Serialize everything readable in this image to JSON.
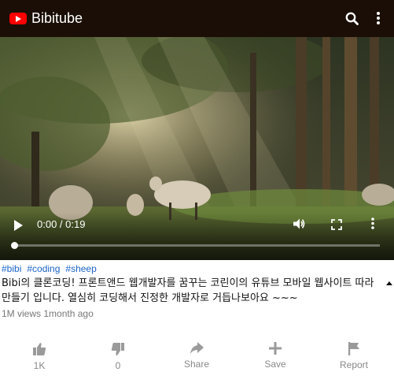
{
  "header": {
    "brand": "Bibitube",
    "logo_icon": "youtube-play-icon",
    "actions": [
      "search-icon",
      "more-vertical-icon"
    ]
  },
  "player": {
    "time": "0:00 / 0:19",
    "progress": 0.0,
    "controls": [
      "play-icon",
      "volume-icon",
      "fullscreen-icon",
      "more-vertical-icon"
    ]
  },
  "video_info": {
    "tags": [
      "#bibi",
      "#coding",
      "#sheep"
    ],
    "title": "Bibi의 클론코딩! 프론트앤드 웹개발자를 꿈꾸는 코린이의 유튜브 모바일 웹사이트 따라 만들기 입니다. 열심히 코딩해서 진정한 개발자로 거듭나보아요 ~~~",
    "views": "1M views",
    "age": "1month ago"
  },
  "actions": [
    {
      "icon": "thumbs-up-icon",
      "label": "1K"
    },
    {
      "icon": "thumbs-down-icon",
      "label": "0"
    },
    {
      "icon": "share-icon",
      "label": "Share"
    },
    {
      "icon": "add-icon",
      "label": "Save"
    },
    {
      "icon": "flag-icon",
      "label": "Report"
    }
  ],
  "colors": {
    "header_bg": "#1a0e06",
    "tag_blue": "#1a64c8",
    "logo_red": "#ff0000"
  }
}
